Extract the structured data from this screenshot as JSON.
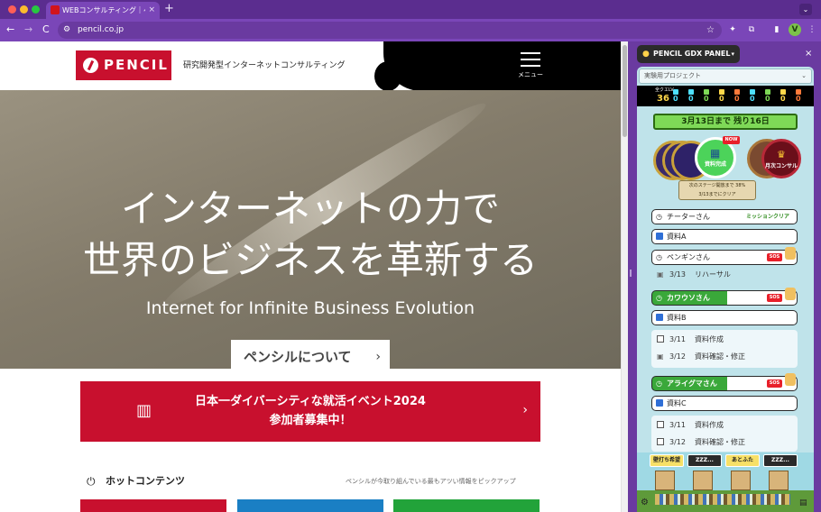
{
  "browser": {
    "tab_title": "WEBコンサルティング｜ペンシル",
    "tab_close": "×",
    "new_tab": "+",
    "tab_menu": "⌄",
    "nav_back": "←",
    "nav_forward": "→",
    "nav_reload": "C",
    "site_info_icon": "⚙",
    "url": "pencil.co.jp",
    "bookmark_star": "☆",
    "avatar_letter": "V",
    "kebab": "⋮",
    "ext1": "✦",
    "ext2": "⧉",
    "side_panel_toggle": "▮"
  },
  "site": {
    "logo_text": "PENCIL",
    "tagline": "研究開発型インターネットコンサルティング",
    "menu_label": "メニュー",
    "hero": {
      "title_line1": "インターネットの力で",
      "title_line2": "世界のビジネスを革新する",
      "subtitle": "Internet for Infinite Business Evolution",
      "button_label": "ペンシルについて",
      "button_arrow": "›"
    },
    "event": {
      "line1": "日本一ダイバーシティな就活イベント2024",
      "line2": "参加者募集中！",
      "icon": "▥",
      "arrow": "›"
    },
    "hot": {
      "icon": "⏻",
      "title": "ホットコンテンツ",
      "desc": "ペンシルが今取り組んでいる最もアツい情報をピックアップ"
    }
  },
  "panel": {
    "title": "PENCIL GDX PANEL",
    "head_icon": "●",
    "caret": "▾",
    "close": "×",
    "project": "実験用プロジェクト",
    "project_caret": "⌄",
    "stats": {
      "total_label": "全クエLV",
      "total_value": "36",
      "values": [
        "0",
        "0",
        "0",
        "0",
        "0",
        "0",
        "0",
        "0",
        "0"
      ],
      "colors": [
        "#4ee0ff",
        "#4ee0ff",
        "#7ed957",
        "#ffd84a",
        "#ff7a3a",
        "#4ee0ff",
        "#7ed957",
        "#ffd84a",
        "#ff7a3a"
      ]
    },
    "countdown": "3月13日まで 残り16日",
    "new_badge": "NOW",
    "active_medal_label": "資料完成",
    "active_medal_icon": "▦",
    "monthly_medal_label": "月次コンサル",
    "monthly_medal_icon": "♛",
    "progress_line1": "次のステージ開放まで 38%",
    "progress_line2": "3/13までにクリア",
    "rows": {
      "cheetah": "チーターさん",
      "cheetah_clear": "ミッションクリア",
      "doc_a": "資料A",
      "penguin": "ペンギンさん",
      "penguin_sched_date": "3/13",
      "penguin_sched_text": "リハーサル",
      "otter": "カワウソさん",
      "doc_b": "資料B",
      "task1_date": "3/11",
      "task1_text": "資料作成",
      "task2_date": "3/12",
      "task2_text": "資料確認・修正",
      "raccoon": "アライグマさん",
      "doc_c": "資料C",
      "task3_date": "3/11",
      "task3_text": "資料作成",
      "task4_date": "3/12",
      "task4_text": "資料確認・修正",
      "tag": "SOS",
      "clock_icon": "◷",
      "sched_icon": "▣"
    },
    "village": {
      "sign1": "壁打ち希望",
      "sign2": "ZZZ...",
      "sign3": "あとふた",
      "sign4": "ZZZ...",
      "gear": "⚙",
      "calendar": "▤"
    }
  }
}
